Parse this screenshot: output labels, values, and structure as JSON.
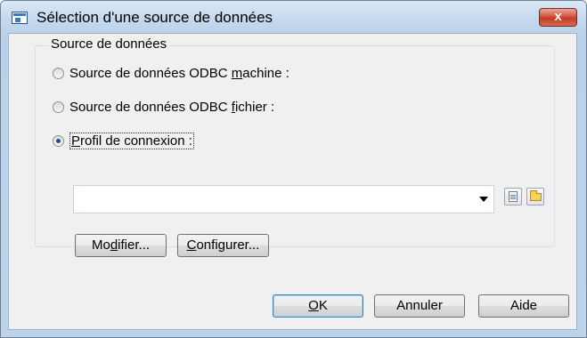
{
  "window": {
    "title": "Sélection d'une source de données",
    "close_glyph": "x",
    "app_icon": "window-app-icon"
  },
  "group": {
    "label": "Source de données",
    "options": [
      {
        "pre": "Source de données ODBC ",
        "accel": "m",
        "post": "achine :",
        "checked": false
      },
      {
        "pre": "Source de données ODBC ",
        "accel": "f",
        "post": "ichier :",
        "checked": false
      },
      {
        "pre": "",
        "accel": "P",
        "post": "rofil de connexion :",
        "checked": true
      }
    ],
    "combo_value": "",
    "icons": [
      "document-icon",
      "folder-icon"
    ],
    "buttons": {
      "modify": {
        "pre": "Mo",
        "accel": "d",
        "post": "ifier..."
      },
      "configure": {
        "pre": "",
        "accel": "C",
        "post": "onfigurer..."
      }
    }
  },
  "footer": {
    "ok": {
      "accel": "O",
      "post": "K"
    },
    "cancel": "Annuler",
    "help": "Aide"
  }
}
